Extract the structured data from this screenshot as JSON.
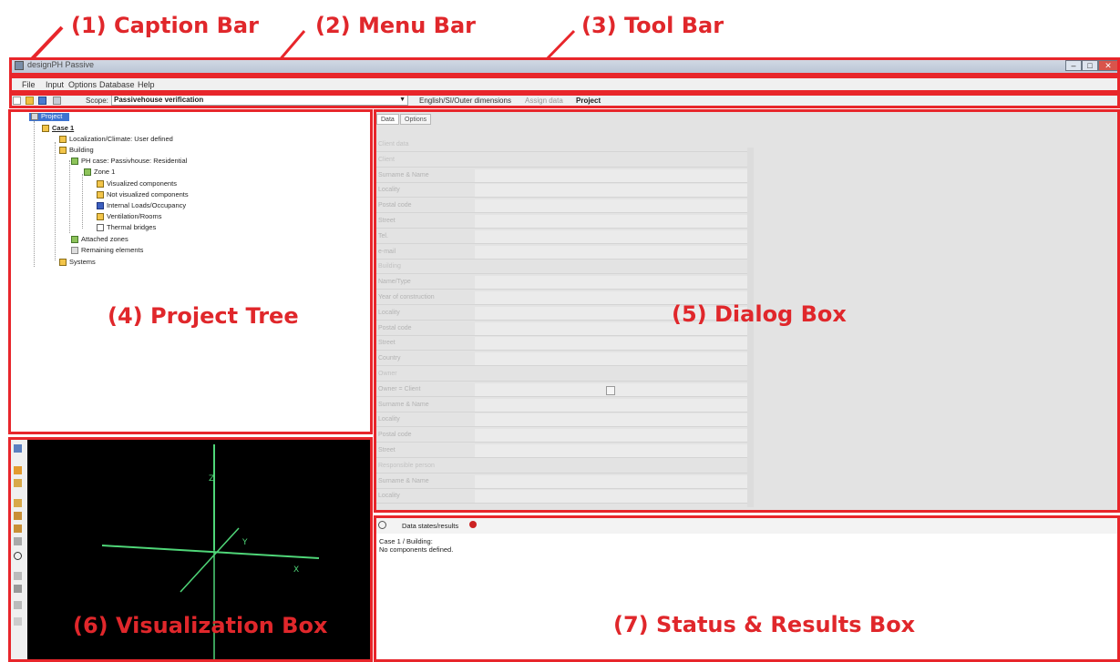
{
  "annotations": {
    "caption_bar": "(1) Caption Bar",
    "menu_bar": "(2) Menu Bar",
    "tool_bar": "(3) Tool Bar",
    "project_tree": "(4) Project Tree",
    "dialog_box": "(5) Dialog Box",
    "visualization_box": "(6) Visualization Box",
    "status_results_box": "(7) Status & Results Box",
    "color": "#e0272b"
  },
  "caption": {
    "title": "designPH Passive"
  },
  "menu": [
    "File",
    "Input",
    "Options",
    "Database",
    "Help"
  ],
  "toolbar": {
    "scope_label": "Scope:",
    "scope_value": "Passivehouse verification",
    "language": "English/SI/Outer dimensions",
    "assign": "Assign data",
    "project": "Project"
  },
  "tree": {
    "root": "Project",
    "nodes": [
      "Case 1",
      "Localization/Climate: User defined",
      "Building",
      "PH case: Passivhouse: Residential",
      "Zone 1",
      "Visualized components",
      "Not visualized components",
      "Internal Loads/Occupancy",
      "Ventilation/Rooms",
      "Thermal bridges",
      "Attached zones",
      "Remaining elements",
      "Systems"
    ]
  },
  "dialog": {
    "tabs": [
      "Data",
      "Options"
    ],
    "rows": [
      {
        "label": "Client data",
        "section": true
      },
      {
        "label": "Client",
        "section": true
      },
      {
        "label": "Surname & Name"
      },
      {
        "label": "Locality"
      },
      {
        "label": "Postal code"
      },
      {
        "label": "Street"
      },
      {
        "label": "Tel."
      },
      {
        "label": "e-mail"
      },
      {
        "label": "Building",
        "section": true
      },
      {
        "label": "Name/Type"
      },
      {
        "label": "Year of construction"
      },
      {
        "label": "Locality"
      },
      {
        "label": "Postal code"
      },
      {
        "label": "Street"
      },
      {
        "label": "Country"
      },
      {
        "label": "Owner",
        "section": true
      },
      {
        "label": "Owner = Client"
      },
      {
        "label": "Surname & Name"
      },
      {
        "label": "Locality"
      },
      {
        "label": "Postal code"
      },
      {
        "label": "Street"
      },
      {
        "label": "Responsible person",
        "section": true
      },
      {
        "label": "Surname & Name"
      },
      {
        "label": "Locality"
      }
    ]
  },
  "visualization": {
    "axis_z": "Z",
    "axis_y": "Y",
    "axis_x": "X",
    "axis_color": "#4fd678"
  },
  "status": {
    "tab": "Data states/results",
    "line1": "Case 1 / Building:",
    "line2": "No components defined."
  }
}
